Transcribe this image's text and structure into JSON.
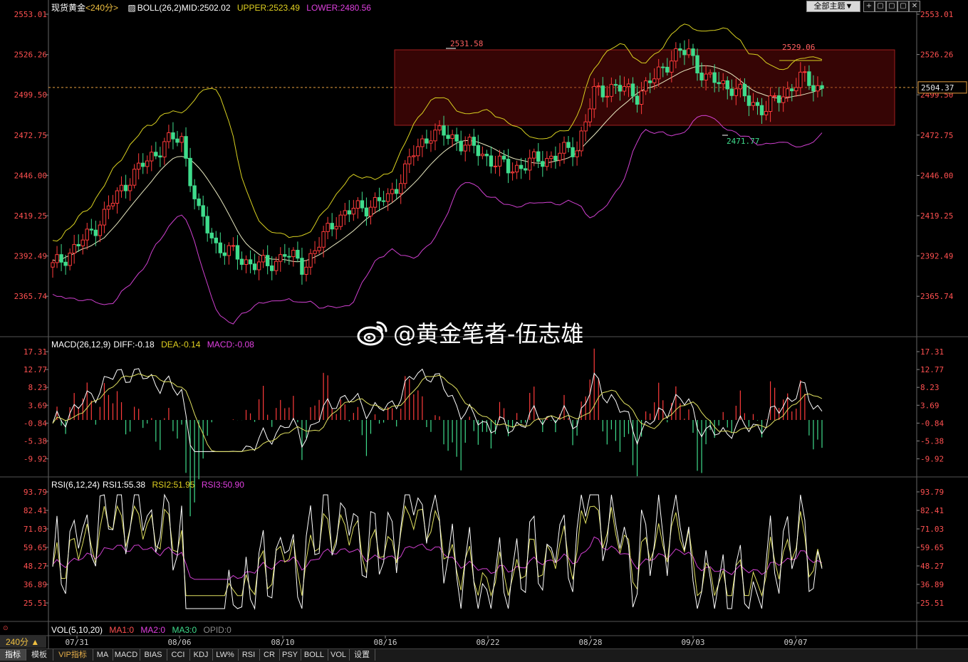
{
  "header": {
    "symbol": "现货黄金",
    "period_tag": "<240分>",
    "boll_label": "BOLL(26,2)",
    "boll_mid": "MID:2502.02",
    "boll_upper": "UPPER:2523.49",
    "boll_lower": "LOWER:2480.56",
    "theme_button": "全部主题▼",
    "window_buttons": [
      "+",
      "▢",
      "▢",
      "▢",
      "✕"
    ]
  },
  "macd_header": {
    "label": "MACD(26,12,9)",
    "diff": "DIFF:-0.18",
    "dea": "DEA:-0.14",
    "macd": "MACD:-0.08"
  },
  "rsi_header": {
    "label": "RSI(6,12,24)",
    "rsi1": "RSI1:55.38",
    "rsi2": "RSI2:51.95",
    "rsi3": "RSI3:50.90"
  },
  "vol_header": {
    "label": "VOL(5,10,20)",
    "ma1": "MA1:0",
    "ma2": "MA2:0",
    "ma3": "MA3:0",
    "opid": "OPID:0"
  },
  "price_axis": [
    "2553.01",
    "2526.26",
    "2499.50",
    "2472.75",
    "2446.00",
    "2419.25",
    "2392.49",
    "2365.74"
  ],
  "macd_axis": [
    "17.31",
    "12.77",
    "8.23",
    "3.69",
    "-0.84",
    "-5.38",
    "-9.92"
  ],
  "rsi_axis": [
    "93.79",
    "82.41",
    "71.03",
    "59.65",
    "48.27",
    "36.89",
    "25.51"
  ],
  "current_price": "2504.37",
  "annotations": {
    "high1": "2531.58",
    "high2": "2529.06",
    "low1": "2471.77"
  },
  "dates": [
    "07/31",
    "08/06",
    "08/10",
    "08/16",
    "08/22",
    "08/28",
    "09/03",
    "09/07"
  ],
  "period_button": "240分 ▲",
  "tabs": [
    "指标",
    "模板",
    "VIP指标",
    "MA",
    "MACD",
    "BIAS",
    "CCI",
    "KDJ",
    "LW%",
    "RSI",
    "CR",
    "PSY",
    "BOLL",
    "VOL",
    "设置"
  ],
  "watermark": "@黄金笔者-伍志雄",
  "colors": {
    "up": "#ff3b3b",
    "down": "#3fdc8c",
    "upper": "#d8d020",
    "mid": "#e8e8c0",
    "lower": "#d040d0",
    "diff": "#ffffff",
    "dea": "#e0e060",
    "rsi3": "#d040d0",
    "axis": "#ff5050"
  }
}
